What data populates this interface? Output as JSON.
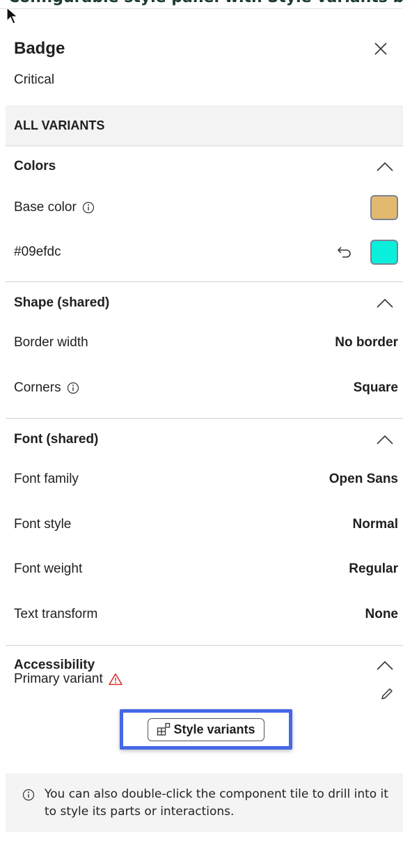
{
  "banner": {
    "text": "Configurable style panel with Style variants button"
  },
  "panel": {
    "title": "Badge",
    "subtitle": "Critical",
    "all_variants_label": "ALL VARIANTS"
  },
  "colors": {
    "title": "Colors",
    "base_color_label": "Base color",
    "base_color_value": "#e3b86f",
    "override_label": "#09efdc",
    "override_color": "#09efdc"
  },
  "shape": {
    "title": "Shape (shared)",
    "border_width_label": "Border width",
    "border_width_value": "No border",
    "corners_label": "Corners",
    "corners_value": "Square"
  },
  "font": {
    "title": "Font (shared)",
    "family_label": "Font family",
    "family_value": "Open Sans",
    "style_label": "Font style",
    "style_value": "Normal",
    "weight_label": "Font weight",
    "weight_value": "Regular",
    "transform_label": "Text transform",
    "transform_value": "None"
  },
  "accessibility": {
    "title": "Accessibility",
    "primary_variant_label": "Primary variant"
  },
  "actions": {
    "style_variants_label": "Style variants"
  },
  "info": {
    "text": "You can also double-click the component tile to drill into it to style its parts or interactions."
  },
  "icons": {
    "close": "close-icon",
    "chevron": "chevron-up-icon",
    "info": "info-icon",
    "reset": "undo-icon",
    "warning": "warning-icon",
    "pencil": "pencil-icon",
    "variants": "variants-icon"
  },
  "accent": {
    "highlight": "#4668e6",
    "warning": "#d6322e"
  }
}
